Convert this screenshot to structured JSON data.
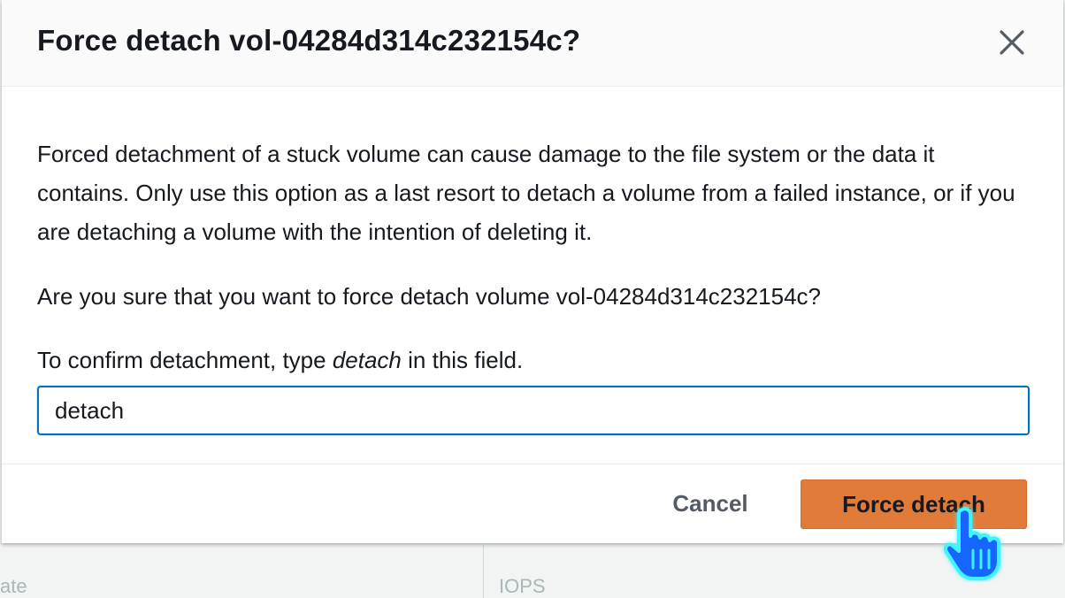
{
  "modal": {
    "title": "Force detach vol-04284d314c232154c?",
    "close_icon": "close-icon",
    "warning_text": "Forced detachment of a stuck volume can cause damage to the file system or the data it contains. Only use this option as a last resort to detach a volume from a failed instance, or if you are detaching a volume with the intention of deleting it.",
    "question_text": "Are you sure that you want to force detach volume vol-04284d314c232154c?",
    "confirm_prefix": "To confirm detachment, type ",
    "confirm_keyword": "detach",
    "confirm_suffix": " in this field.",
    "input_value": "detach",
    "cancel_label": "Cancel",
    "confirm_label": "Force detach"
  },
  "background": {
    "left_label": "ate",
    "right_label": "IOPS"
  },
  "colors": {
    "primary_button": "#e07b39",
    "input_focus_border": "#0073bb",
    "cursor_fill": "#1565ff",
    "cursor_glow": "#3ff3ff"
  },
  "cursor_icon": "hand-pointer-icon"
}
